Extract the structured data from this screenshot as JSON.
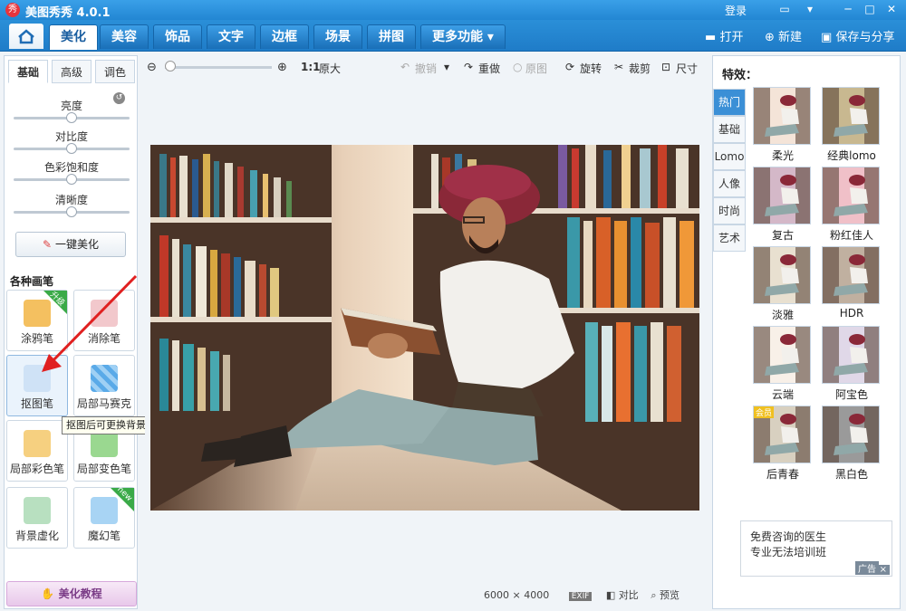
{
  "app": {
    "logo_char": "秀",
    "title": "美图秀秀 4.0.1",
    "login": "登录"
  },
  "main_tabs": [
    "美化",
    "美容",
    "饰品",
    "文字",
    "边框",
    "场景",
    "拼图",
    "更多功能"
  ],
  "main_tab_arrow": "▾",
  "top_right": {
    "open": "打开",
    "new": "新建",
    "save_share": "保存与分享"
  },
  "left": {
    "subtabs": [
      "基础",
      "高级",
      "调色"
    ],
    "sliders": [
      {
        "label": "亮度",
        "value": 0.5
      },
      {
        "label": "对比度",
        "value": 0.5
      },
      {
        "label": "色彩饱和度",
        "value": 0.5
      },
      {
        "label": "清晰度",
        "value": 0.5
      }
    ],
    "one_click": "一键美化",
    "brush_header": "各种画笔",
    "brushes": [
      {
        "label": "涂鸦笔",
        "badge": "升级",
        "color": "#e8a020"
      },
      {
        "label": "消除笔",
        "badge": "",
        "color": "#e8a0a8"
      },
      {
        "label": "抠图笔",
        "badge": "",
        "color": "#2f7fd0"
      },
      {
        "label": "局部马赛克",
        "badge": "",
        "color": "#4aa0e8"
      },
      {
        "label": "局部彩色笔",
        "badge": "",
        "color": "#f0b030"
      },
      {
        "label": "局部变色笔",
        "badge": "",
        "color": "#40b050"
      },
      {
        "label": "背景虚化",
        "badge": "",
        "color": "#48a868"
      },
      {
        "label": "魔幻笔",
        "badge": "new",
        "color": "#3a98e0"
      }
    ],
    "tooltip": "抠图后可更换背景、合成图片",
    "tutorial": "美化教程"
  },
  "toolbar": {
    "original_size": "原大",
    "one_to_one": "1:1",
    "undo": "撤销",
    "redo": "重做",
    "original": "原图",
    "rotate": "旋转",
    "crop": "裁剪",
    "size": "尺寸"
  },
  "zoom_level": 0.05,
  "status": {
    "width": "6000",
    "x": "×",
    "height": "4000",
    "exif": "EXIF",
    "compare": "对比",
    "preview": "预览"
  },
  "right": {
    "title": "特效：",
    "categories": [
      "热门",
      "基础",
      "Lomo",
      "人像",
      "时尚",
      "艺术"
    ],
    "effects": [
      {
        "label": "柔光",
        "tint": "#f4e4d8",
        "badge": ""
      },
      {
        "label": "经典lomo",
        "tint": "#c8b890",
        "badge": ""
      },
      {
        "label": "复古",
        "tint": "#d4b8c8",
        "badge": ""
      },
      {
        "label": "粉红佳人",
        "tint": "#f0c0c8",
        "badge": ""
      },
      {
        "label": "淡雅",
        "tint": "#e8e0d0",
        "badge": ""
      },
      {
        "label": "HDR",
        "tint": "#c0b0a0",
        "badge": ""
      },
      {
        "label": "云端",
        "tint": "#f8f0e8",
        "badge": ""
      },
      {
        "label": "阿宝色",
        "tint": "#e0d8e8",
        "badge": ""
      },
      {
        "label": "后青春",
        "tint": "#d8d0c0",
        "badge": "会员"
      },
      {
        "label": "黑白色",
        "tint": "#9a9a9a",
        "badge": ""
      }
    ],
    "ad_line1": "免费咨询的医生",
    "ad_line2": "专业无法培训班",
    "ad_tag": "广告",
    "ad_close": "×"
  },
  "accent_color": "#2286d3"
}
